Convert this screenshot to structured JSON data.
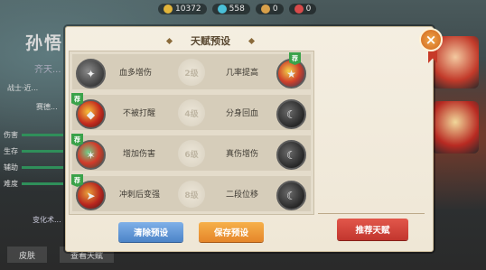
{
  "topbar": {
    "gold": "10372",
    "gems": "558",
    "tickets": "0",
    "hearts": "0"
  },
  "hero": {
    "name": "孙悟",
    "subtitle": "齐天..."
  },
  "left_panel": {
    "rows": [
      {
        "label": "伤害"
      },
      {
        "label": "生存"
      },
      {
        "label": "辅助"
      },
      {
        "label": "难度"
      }
    ],
    "tag1": "战士·近...",
    "skin": "赛德...",
    "note": "变化术..."
  },
  "bottom_tabs": [
    "皮肤",
    "查看天赋"
  ],
  "modal": {
    "title": "天赋预设",
    "close_symbol": "×",
    "rows": [
      {
        "left_label": "血多增伤",
        "level": "2级",
        "right_label": "几率提高",
        "left_icon": "sword-icon",
        "right_icon": "monkey-king-talent-icon",
        "left_active": false,
        "right_active": true,
        "tag": "荐"
      },
      {
        "left_label": "不被打醒",
        "level": "4级",
        "right_label": "分身回血",
        "left_icon": "awaken-shield-icon",
        "right_icon": "clone-heal-icon",
        "left_active": true,
        "right_active": false,
        "tag": "荐"
      },
      {
        "left_label": "增加伤害",
        "level": "6级",
        "right_label": "真伤增伤",
        "left_icon": "damage-boost-icon",
        "right_icon": "true-damage-icon",
        "left_active": true,
        "right_active": false,
        "tag": "荐"
      },
      {
        "left_label": "冲刺后变强",
        "level": "8级",
        "right_label": "二段位移",
        "left_icon": "dash-power-icon",
        "right_icon": "double-dash-icon",
        "left_active": true,
        "right_active": false,
        "tag": "荐"
      }
    ],
    "buttons": {
      "clear": "清除预设",
      "save": "保存预设",
      "recommend": "推荐天赋"
    }
  },
  "colors": {
    "clear_button": "#4c84c8",
    "save_button": "#e5862a",
    "recommend_button": "#c2362e",
    "recommend_tag": "#3aa24a",
    "modal_bg": "#f4eee1"
  }
}
